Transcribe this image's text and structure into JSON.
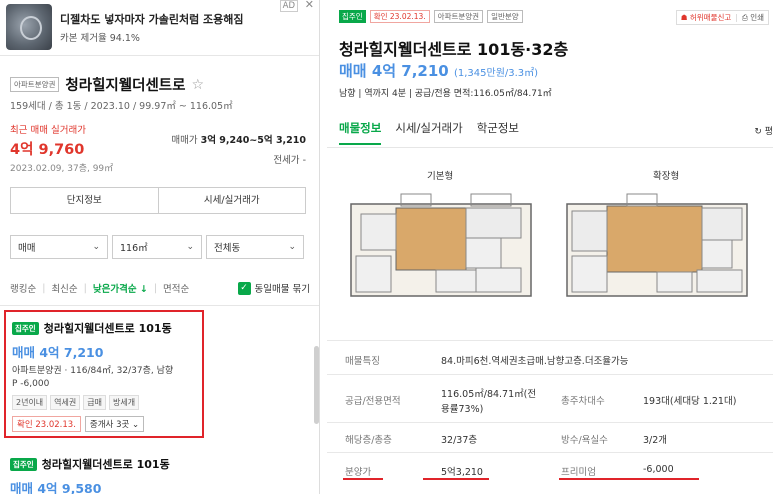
{
  "ad": {
    "title": "디젤차도 넣자마자 가솔린처럼 조용해짐",
    "subtitle": "카본 제거율 94.1%",
    "badge": "AD",
    "close": "✕"
  },
  "complex": {
    "type_badge": "아파트분양권",
    "name": "청라힐지웰더센트로",
    "star": "☆",
    "meta": "159세대 / 총 1동 / 2023.10 / 99.97㎡ ~ 116.05㎡",
    "recent_label": "최근 매매 실거래가",
    "recent_price": "4억 9,760",
    "recent_date": "2023.02.09, 37층, 99㎡",
    "range_label": "매매가",
    "range_value": "3억 9,240~5억 3,210",
    "jeonse": "전세가 -"
  },
  "sub_tabs": [
    "단지정보",
    "시세/실거래가"
  ],
  "filters": [
    {
      "label": "매매",
      "chevron": "⌄"
    },
    {
      "label": "116㎡",
      "chevron": "⌄"
    },
    {
      "label": "전체동",
      "chevron": "⌄"
    }
  ],
  "sort": {
    "options": [
      "랭킹순",
      "최신순",
      "낮은가격순 ↓",
      "면적순"
    ],
    "same_listing_label": "동일매물 묶기",
    "check": "✓"
  },
  "listings": [
    {
      "badge": "집주인",
      "title": "청라힐지웰더센트로 101동",
      "price": "매매 4억 7,210",
      "desc": "아파트분양권 · 116/84㎡, 32/37층, 남향",
      "pp": "P -6,000",
      "tags": [
        "2년이내",
        "역세권",
        "급매",
        "방세개"
      ],
      "confirm": "확인 23.02.13.",
      "agents": "중개사 3곳 ⌄"
    },
    {
      "badge": "집주인",
      "title": "청라힐지웰더센트로 101동",
      "price": "매매 4억 9,580"
    }
  ],
  "detail": {
    "badges": {
      "owner": "집주인",
      "confirm": "확인 23.02.13.",
      "type": "아파트분양권",
      "kind": "일반분양"
    },
    "report": "☗ 허위매물신고",
    "print": "⎙ 인쇄",
    "title": "청라힐지웰더센트로 101동·32층",
    "price": "매매 4억 7,210",
    "price_per": "(1,345만원/3.3㎡)",
    "meta": "남향 | 역까지 4분 | 공급/전용 면적:116.05㎡/84.71㎡",
    "tabs": [
      "매물정보",
      "시세/실거래가",
      "학군정보"
    ],
    "refresh": "↻ 평",
    "plans": [
      "기본형",
      "확장형"
    ],
    "info": {
      "feature_key": "매물특징",
      "feature_val": "84.마피6천.역세권초급매.남향고층.더조율가능",
      "area_key": "공급/전용면적",
      "area_val_1": "116.05㎡/84.71㎡(전",
      "area_val_2": "용률73%)",
      "households_key": "총주차대수",
      "households_val": "193대(세대당 1.21대)",
      "floor_key": "해당층/총층",
      "floor_val": "32/37층",
      "rooms_key": "방수/욕실수",
      "rooms_val": "3/2개",
      "sale_key": "분양가",
      "sale_val": "5억3,210",
      "premium_key": "프리미엄",
      "premium_val": "-6,000"
    }
  },
  "colors": {
    "green": "#09a84a",
    "red": "#e0242a",
    "blue": "#4a90e2"
  }
}
